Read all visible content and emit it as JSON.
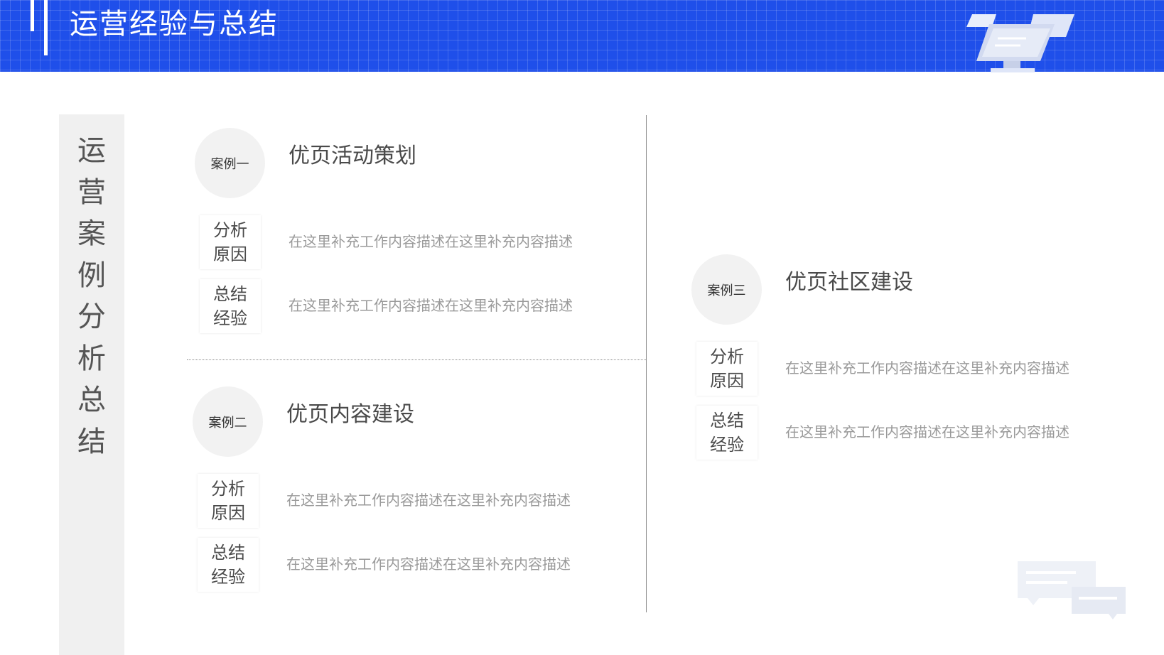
{
  "header": {
    "title": "运营经验与总结"
  },
  "side_label": "运\n营\n案\n例\n分\n析\n总\n结",
  "cases": [
    {
      "badge": "案例一",
      "title": "优页活动策划",
      "rows": [
        {
          "tag": "分析\n原因",
          "text": "在这里补充工作内容描述在这里补充内容描述"
        },
        {
          "tag": "总结\n经验",
          "text": "在这里补充工作内容描述在这里补充内容描述"
        }
      ]
    },
    {
      "badge": "案例二",
      "title": "优页内容建设",
      "rows": [
        {
          "tag": "分析\n原因",
          "text": "在这里补充工作内容描述在这里补充内容描述"
        },
        {
          "tag": "总结\n经验",
          "text": "在这里补充工作内容描述在这里补充内容描述"
        }
      ]
    },
    {
      "badge": "案例三",
      "title": "优页社区建设",
      "rows": [
        {
          "tag": "分析\n原因",
          "text": "在这里补充工作内容描述在这里补充内容描述"
        },
        {
          "tag": "总结\n经验",
          "text": "在这里补充工作内容描述在这里补充内容描述"
        }
      ]
    }
  ],
  "icons": {
    "monitor": "monitor-icon",
    "chat": "chat-bubbles-icon"
  },
  "colors": {
    "banner": "#1f4fea",
    "badge_bg": "#f2f2f2",
    "side_bg": "#f0f0f0",
    "desc_text": "#9a9a9a"
  }
}
